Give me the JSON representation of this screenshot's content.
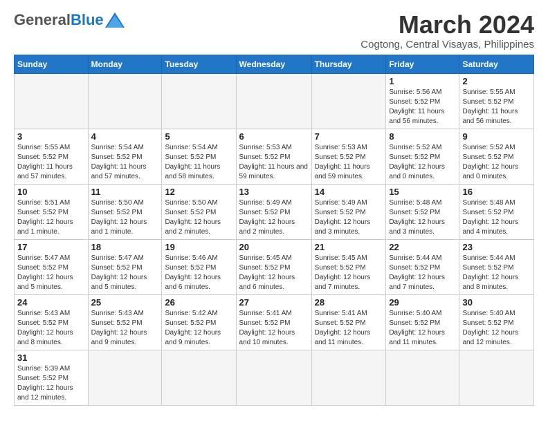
{
  "header": {
    "logo_general": "General",
    "logo_blue": "Blue",
    "month_title": "March 2024",
    "location": "Cogtong, Central Visayas, Philippines"
  },
  "days_of_week": [
    "Sunday",
    "Monday",
    "Tuesday",
    "Wednesday",
    "Thursday",
    "Friday",
    "Saturday"
  ],
  "weeks": [
    [
      {
        "day": "",
        "info": ""
      },
      {
        "day": "",
        "info": ""
      },
      {
        "day": "",
        "info": ""
      },
      {
        "day": "",
        "info": ""
      },
      {
        "day": "",
        "info": ""
      },
      {
        "day": "1",
        "info": "Sunrise: 5:56 AM\nSunset: 5:52 PM\nDaylight: 11 hours and 56 minutes."
      },
      {
        "day": "2",
        "info": "Sunrise: 5:55 AM\nSunset: 5:52 PM\nDaylight: 11 hours and 56 minutes."
      }
    ],
    [
      {
        "day": "3",
        "info": "Sunrise: 5:55 AM\nSunset: 5:52 PM\nDaylight: 11 hours and 57 minutes."
      },
      {
        "day": "4",
        "info": "Sunrise: 5:54 AM\nSunset: 5:52 PM\nDaylight: 11 hours and 57 minutes."
      },
      {
        "day": "5",
        "info": "Sunrise: 5:54 AM\nSunset: 5:52 PM\nDaylight: 11 hours and 58 minutes."
      },
      {
        "day": "6",
        "info": "Sunrise: 5:53 AM\nSunset: 5:52 PM\nDaylight: 11 hours and 59 minutes."
      },
      {
        "day": "7",
        "info": "Sunrise: 5:53 AM\nSunset: 5:52 PM\nDaylight: 11 hours and 59 minutes."
      },
      {
        "day": "8",
        "info": "Sunrise: 5:52 AM\nSunset: 5:52 PM\nDaylight: 12 hours and 0 minutes."
      },
      {
        "day": "9",
        "info": "Sunrise: 5:52 AM\nSunset: 5:52 PM\nDaylight: 12 hours and 0 minutes."
      }
    ],
    [
      {
        "day": "10",
        "info": "Sunrise: 5:51 AM\nSunset: 5:52 PM\nDaylight: 12 hours and 1 minute."
      },
      {
        "day": "11",
        "info": "Sunrise: 5:50 AM\nSunset: 5:52 PM\nDaylight: 12 hours and 1 minute."
      },
      {
        "day": "12",
        "info": "Sunrise: 5:50 AM\nSunset: 5:52 PM\nDaylight: 12 hours and 2 minutes."
      },
      {
        "day": "13",
        "info": "Sunrise: 5:49 AM\nSunset: 5:52 PM\nDaylight: 12 hours and 2 minutes."
      },
      {
        "day": "14",
        "info": "Sunrise: 5:49 AM\nSunset: 5:52 PM\nDaylight: 12 hours and 3 minutes."
      },
      {
        "day": "15",
        "info": "Sunrise: 5:48 AM\nSunset: 5:52 PM\nDaylight: 12 hours and 3 minutes."
      },
      {
        "day": "16",
        "info": "Sunrise: 5:48 AM\nSunset: 5:52 PM\nDaylight: 12 hours and 4 minutes."
      }
    ],
    [
      {
        "day": "17",
        "info": "Sunrise: 5:47 AM\nSunset: 5:52 PM\nDaylight: 12 hours and 5 minutes."
      },
      {
        "day": "18",
        "info": "Sunrise: 5:47 AM\nSunset: 5:52 PM\nDaylight: 12 hours and 5 minutes."
      },
      {
        "day": "19",
        "info": "Sunrise: 5:46 AM\nSunset: 5:52 PM\nDaylight: 12 hours and 6 minutes."
      },
      {
        "day": "20",
        "info": "Sunrise: 5:45 AM\nSunset: 5:52 PM\nDaylight: 12 hours and 6 minutes."
      },
      {
        "day": "21",
        "info": "Sunrise: 5:45 AM\nSunset: 5:52 PM\nDaylight: 12 hours and 7 minutes."
      },
      {
        "day": "22",
        "info": "Sunrise: 5:44 AM\nSunset: 5:52 PM\nDaylight: 12 hours and 7 minutes."
      },
      {
        "day": "23",
        "info": "Sunrise: 5:44 AM\nSunset: 5:52 PM\nDaylight: 12 hours and 8 minutes."
      }
    ],
    [
      {
        "day": "24",
        "info": "Sunrise: 5:43 AM\nSunset: 5:52 PM\nDaylight: 12 hours and 8 minutes."
      },
      {
        "day": "25",
        "info": "Sunrise: 5:43 AM\nSunset: 5:52 PM\nDaylight: 12 hours and 9 minutes."
      },
      {
        "day": "26",
        "info": "Sunrise: 5:42 AM\nSunset: 5:52 PM\nDaylight: 12 hours and 9 minutes."
      },
      {
        "day": "27",
        "info": "Sunrise: 5:41 AM\nSunset: 5:52 PM\nDaylight: 12 hours and 10 minutes."
      },
      {
        "day": "28",
        "info": "Sunrise: 5:41 AM\nSunset: 5:52 PM\nDaylight: 12 hours and 11 minutes."
      },
      {
        "day": "29",
        "info": "Sunrise: 5:40 AM\nSunset: 5:52 PM\nDaylight: 12 hours and 11 minutes."
      },
      {
        "day": "30",
        "info": "Sunrise: 5:40 AM\nSunset: 5:52 PM\nDaylight: 12 hours and 12 minutes."
      }
    ],
    [
      {
        "day": "31",
        "info": "Sunrise: 5:39 AM\nSunset: 5:52 PM\nDaylight: 12 hours and 12 minutes."
      },
      {
        "day": "",
        "info": ""
      },
      {
        "day": "",
        "info": ""
      },
      {
        "day": "",
        "info": ""
      },
      {
        "day": "",
        "info": ""
      },
      {
        "day": "",
        "info": ""
      },
      {
        "day": "",
        "info": ""
      }
    ]
  ]
}
